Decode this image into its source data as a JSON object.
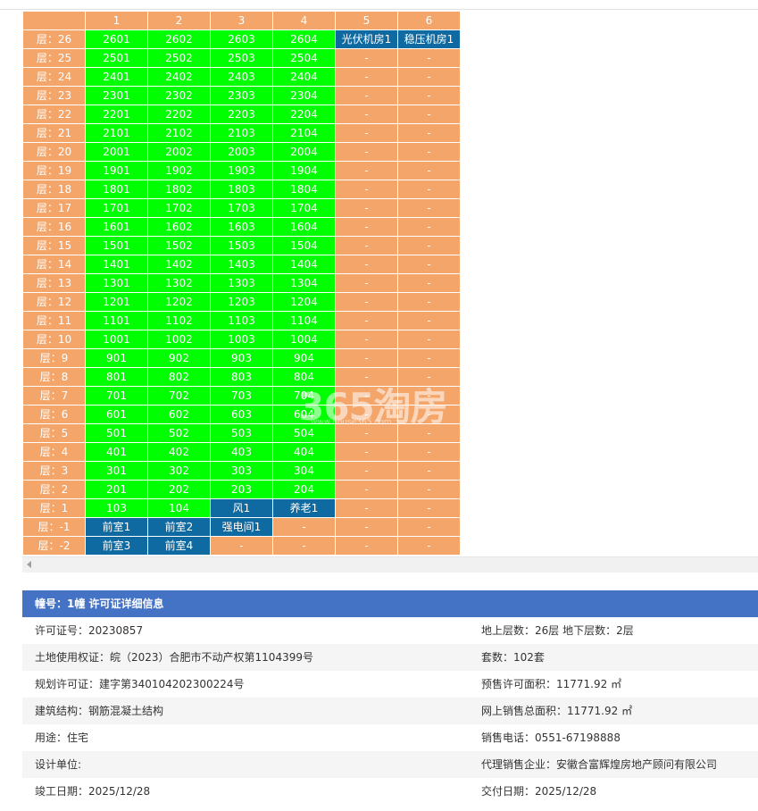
{
  "columns": [
    "",
    "1",
    "2",
    "3",
    "4",
    "5",
    "6"
  ],
  "rows": [
    {
      "label": "层：26",
      "cells": [
        {
          "t": "2601",
          "s": "gr"
        },
        {
          "t": "2602",
          "s": "gr"
        },
        {
          "t": "2603",
          "s": "gr"
        },
        {
          "t": "2604",
          "s": "gr"
        },
        {
          "t": "光伏机房1",
          "s": "bl"
        },
        {
          "t": "稳压机房1",
          "s": "bl"
        }
      ]
    },
    {
      "label": "层：25",
      "cells": [
        {
          "t": "2501",
          "s": "gr"
        },
        {
          "t": "2502",
          "s": "gr"
        },
        {
          "t": "2503",
          "s": "gr"
        },
        {
          "t": "2504",
          "s": "gr"
        },
        {
          "t": "-",
          "s": "dash"
        },
        {
          "t": "-",
          "s": "dash"
        }
      ]
    },
    {
      "label": "层：24",
      "cells": [
        {
          "t": "2401",
          "s": "gr"
        },
        {
          "t": "2402",
          "s": "gr"
        },
        {
          "t": "2403",
          "s": "gr"
        },
        {
          "t": "2404",
          "s": "gr"
        },
        {
          "t": "-",
          "s": "dash"
        },
        {
          "t": "-",
          "s": "dash"
        }
      ]
    },
    {
      "label": "层：23",
      "cells": [
        {
          "t": "2301",
          "s": "gr"
        },
        {
          "t": "2302",
          "s": "gr"
        },
        {
          "t": "2303",
          "s": "gr"
        },
        {
          "t": "2304",
          "s": "gr"
        },
        {
          "t": "-",
          "s": "dash"
        },
        {
          "t": "-",
          "s": "dash"
        }
      ]
    },
    {
      "label": "层：22",
      "cells": [
        {
          "t": "2201",
          "s": "gr"
        },
        {
          "t": "2202",
          "s": "gr"
        },
        {
          "t": "2203",
          "s": "gr"
        },
        {
          "t": "2204",
          "s": "gr"
        },
        {
          "t": "-",
          "s": "dash"
        },
        {
          "t": "-",
          "s": "dash"
        }
      ]
    },
    {
      "label": "层：21",
      "cells": [
        {
          "t": "2101",
          "s": "gr"
        },
        {
          "t": "2102",
          "s": "gr"
        },
        {
          "t": "2103",
          "s": "gr"
        },
        {
          "t": "2104",
          "s": "gr"
        },
        {
          "t": "-",
          "s": "dash"
        },
        {
          "t": "-",
          "s": "dash"
        }
      ]
    },
    {
      "label": "层：20",
      "cells": [
        {
          "t": "2001",
          "s": "gr"
        },
        {
          "t": "2002",
          "s": "gr"
        },
        {
          "t": "2003",
          "s": "gr"
        },
        {
          "t": "2004",
          "s": "gr"
        },
        {
          "t": "-",
          "s": "dash"
        },
        {
          "t": "-",
          "s": "dash"
        }
      ]
    },
    {
      "label": "层：19",
      "cells": [
        {
          "t": "1901",
          "s": "gr"
        },
        {
          "t": "1902",
          "s": "gr"
        },
        {
          "t": "1903",
          "s": "gr"
        },
        {
          "t": "1904",
          "s": "gr"
        },
        {
          "t": "-",
          "s": "dash"
        },
        {
          "t": "-",
          "s": "dash"
        }
      ]
    },
    {
      "label": "层：18",
      "cells": [
        {
          "t": "1801",
          "s": "gr"
        },
        {
          "t": "1802",
          "s": "gr"
        },
        {
          "t": "1803",
          "s": "gr"
        },
        {
          "t": "1804",
          "s": "gr"
        },
        {
          "t": "-",
          "s": "dash"
        },
        {
          "t": "-",
          "s": "dash"
        }
      ]
    },
    {
      "label": "层：17",
      "cells": [
        {
          "t": "1701",
          "s": "gr"
        },
        {
          "t": "1702",
          "s": "gr"
        },
        {
          "t": "1703",
          "s": "gr"
        },
        {
          "t": "1704",
          "s": "gr"
        },
        {
          "t": "-",
          "s": "dash"
        },
        {
          "t": "-",
          "s": "dash"
        }
      ]
    },
    {
      "label": "层：16",
      "cells": [
        {
          "t": "1601",
          "s": "gr"
        },
        {
          "t": "1602",
          "s": "gr"
        },
        {
          "t": "1603",
          "s": "gr"
        },
        {
          "t": "1604",
          "s": "gr"
        },
        {
          "t": "-",
          "s": "dash"
        },
        {
          "t": "-",
          "s": "dash"
        }
      ]
    },
    {
      "label": "层：15",
      "cells": [
        {
          "t": "1501",
          "s": "gr"
        },
        {
          "t": "1502",
          "s": "gr"
        },
        {
          "t": "1503",
          "s": "gr"
        },
        {
          "t": "1504",
          "s": "gr"
        },
        {
          "t": "-",
          "s": "dash"
        },
        {
          "t": "-",
          "s": "dash"
        }
      ]
    },
    {
      "label": "层：14",
      "cells": [
        {
          "t": "1401",
          "s": "gr"
        },
        {
          "t": "1402",
          "s": "gr"
        },
        {
          "t": "1403",
          "s": "gr"
        },
        {
          "t": "1404",
          "s": "gr"
        },
        {
          "t": "-",
          "s": "dash"
        },
        {
          "t": "-",
          "s": "dash"
        }
      ]
    },
    {
      "label": "层：13",
      "cells": [
        {
          "t": "1301",
          "s": "gr"
        },
        {
          "t": "1302",
          "s": "gr"
        },
        {
          "t": "1303",
          "s": "gr"
        },
        {
          "t": "1304",
          "s": "gr"
        },
        {
          "t": "-",
          "s": "dash"
        },
        {
          "t": "-",
          "s": "dash"
        }
      ]
    },
    {
      "label": "层：12",
      "cells": [
        {
          "t": "1201",
          "s": "gr"
        },
        {
          "t": "1202",
          "s": "gr"
        },
        {
          "t": "1203",
          "s": "gr"
        },
        {
          "t": "1204",
          "s": "gr"
        },
        {
          "t": "-",
          "s": "dash"
        },
        {
          "t": "-",
          "s": "dash"
        }
      ]
    },
    {
      "label": "层：11",
      "cells": [
        {
          "t": "1101",
          "s": "gr"
        },
        {
          "t": "1102",
          "s": "gr"
        },
        {
          "t": "1103",
          "s": "gr"
        },
        {
          "t": "1104",
          "s": "gr"
        },
        {
          "t": "-",
          "s": "dash"
        },
        {
          "t": "-",
          "s": "dash"
        }
      ]
    },
    {
      "label": "层：10",
      "cells": [
        {
          "t": "1001",
          "s": "gr"
        },
        {
          "t": "1002",
          "s": "gr"
        },
        {
          "t": "1003",
          "s": "gr"
        },
        {
          "t": "1004",
          "s": "gr"
        },
        {
          "t": "-",
          "s": "dash"
        },
        {
          "t": "-",
          "s": "dash"
        }
      ]
    },
    {
      "label": "层：9",
      "cells": [
        {
          "t": "901",
          "s": "gr"
        },
        {
          "t": "902",
          "s": "gr"
        },
        {
          "t": "903",
          "s": "gr"
        },
        {
          "t": "904",
          "s": "gr"
        },
        {
          "t": "-",
          "s": "dash"
        },
        {
          "t": "-",
          "s": "dash"
        }
      ]
    },
    {
      "label": "层：8",
      "cells": [
        {
          "t": "801",
          "s": "gr"
        },
        {
          "t": "802",
          "s": "gr"
        },
        {
          "t": "803",
          "s": "gr"
        },
        {
          "t": "804",
          "s": "gr"
        },
        {
          "t": "-",
          "s": "dash"
        },
        {
          "t": "-",
          "s": "dash"
        }
      ]
    },
    {
      "label": "层：7",
      "cells": [
        {
          "t": "701",
          "s": "gr"
        },
        {
          "t": "702",
          "s": "gr"
        },
        {
          "t": "703",
          "s": "gr"
        },
        {
          "t": "704",
          "s": "gr"
        },
        {
          "t": "-",
          "s": "dash"
        },
        {
          "t": "-",
          "s": "dash"
        }
      ]
    },
    {
      "label": "层：6",
      "cells": [
        {
          "t": "601",
          "s": "gr"
        },
        {
          "t": "602",
          "s": "gr"
        },
        {
          "t": "603",
          "s": "gr"
        },
        {
          "t": "604",
          "s": "gr"
        },
        {
          "t": "-",
          "s": "dash"
        },
        {
          "t": "-",
          "s": "dash"
        }
      ]
    },
    {
      "label": "层：5",
      "cells": [
        {
          "t": "501",
          "s": "gr"
        },
        {
          "t": "502",
          "s": "gr"
        },
        {
          "t": "503",
          "s": "gr"
        },
        {
          "t": "504",
          "s": "gr"
        },
        {
          "t": "-",
          "s": "dash"
        },
        {
          "t": "-",
          "s": "dash"
        }
      ]
    },
    {
      "label": "层：4",
      "cells": [
        {
          "t": "401",
          "s": "gr"
        },
        {
          "t": "402",
          "s": "gr"
        },
        {
          "t": "403",
          "s": "gr"
        },
        {
          "t": "404",
          "s": "gr"
        },
        {
          "t": "-",
          "s": "dash"
        },
        {
          "t": "-",
          "s": "dash"
        }
      ]
    },
    {
      "label": "层：3",
      "cells": [
        {
          "t": "301",
          "s": "gr"
        },
        {
          "t": "302",
          "s": "gr"
        },
        {
          "t": "303",
          "s": "gr"
        },
        {
          "t": "304",
          "s": "gr"
        },
        {
          "t": "-",
          "s": "dash"
        },
        {
          "t": "-",
          "s": "dash"
        }
      ]
    },
    {
      "label": "层：2",
      "cells": [
        {
          "t": "201",
          "s": "gr"
        },
        {
          "t": "202",
          "s": "gr"
        },
        {
          "t": "203",
          "s": "gr"
        },
        {
          "t": "204",
          "s": "gr"
        },
        {
          "t": "-",
          "s": "dash"
        },
        {
          "t": "-",
          "s": "dash"
        }
      ]
    },
    {
      "label": "层：1",
      "cells": [
        {
          "t": "103",
          "s": "gr"
        },
        {
          "t": "104",
          "s": "gr"
        },
        {
          "t": "风1",
          "s": "bl"
        },
        {
          "t": "养老1",
          "s": "bl"
        },
        {
          "t": "-",
          "s": "dash"
        },
        {
          "t": "-",
          "s": "dash"
        }
      ]
    },
    {
      "label": "层：-1",
      "cells": [
        {
          "t": "前室1",
          "s": "bl"
        },
        {
          "t": "前室2",
          "s": "bl"
        },
        {
          "t": "强电间1",
          "s": "bl"
        },
        {
          "t": "-",
          "s": "dash"
        },
        {
          "t": "-",
          "s": "dash"
        },
        {
          "t": "-",
          "s": "dash"
        }
      ]
    },
    {
      "label": "层：-2",
      "cells": [
        {
          "t": "前室3",
          "s": "bl"
        },
        {
          "t": "前室4",
          "s": "bl"
        },
        {
          "t": "-",
          "s": "dash"
        },
        {
          "t": "-",
          "s": "dash"
        },
        {
          "t": "-",
          "s": "dash"
        },
        {
          "t": "-",
          "s": "dash"
        }
      ]
    }
  ],
  "watermark": {
    "brand": "365淘房",
    "site": "www.house365.com"
  },
  "info": {
    "header": "幢号：1幢 许可证详细信息",
    "rows": [
      {
        "left": "许可证号：20230857",
        "right": "地上层数：26层  地下层数：2层"
      },
      {
        "left": "土地使用权证：皖（2023）合肥市不动产权第1104399号",
        "right": "套数：102套"
      },
      {
        "left": "规划许可证：建字第340104202300224号",
        "right": "预售许可面积：11771.92 ㎡"
      },
      {
        "left": "建筑结构：钢筋混凝土结构",
        "right": "网上销售总面积：11771.92 ㎡"
      },
      {
        "left": "用途：住宅",
        "right": "销售电话：0551-67198888"
      },
      {
        "left": "设计单位:",
        "right": "代理销售企业：安徽合富辉煌房地产顾问有限公司"
      },
      {
        "left": "竣工日期：2025/12/28",
        "right": "交付日期：2025/12/28"
      }
    ]
  }
}
